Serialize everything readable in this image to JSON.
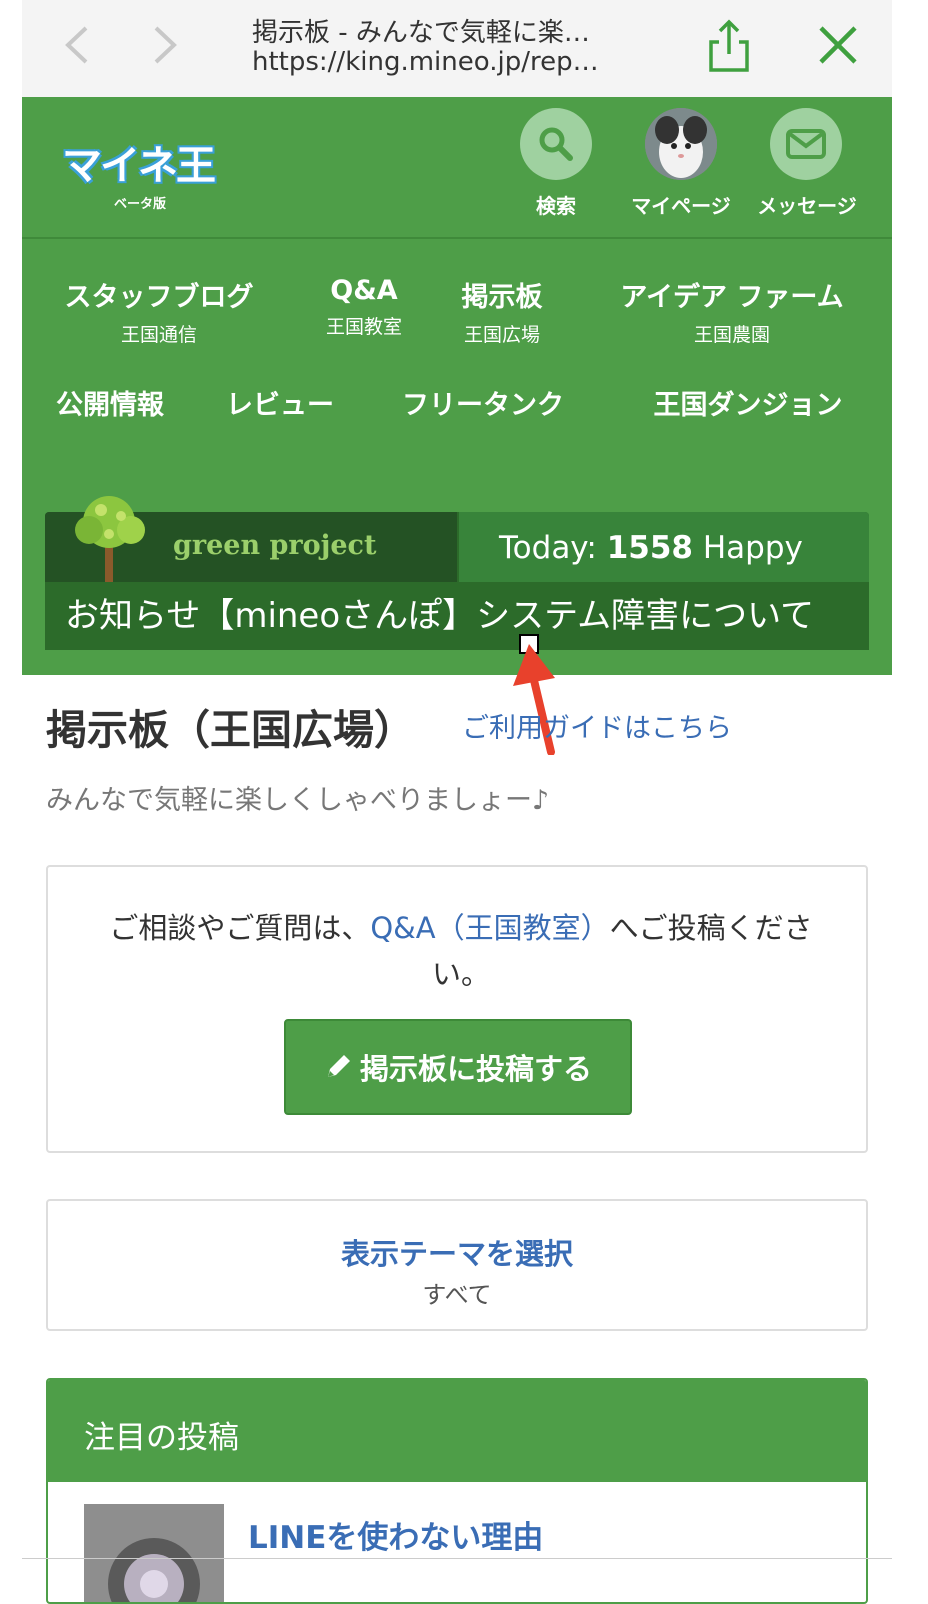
{
  "browser": {
    "title": "掲示板 - みんなで気軽に楽…",
    "url": "https://king.mineo.jp/rep…",
    "back_icon": "chevron-left-icon",
    "forward_icon": "chevron-right-icon",
    "share_icon": "share-icon",
    "close_icon": "close-icon"
  },
  "header": {
    "logo_text": "マイネ王",
    "logo_sub": "ベータ版",
    "actions": [
      {
        "label": "検索",
        "icon": "search-icon"
      },
      {
        "label": "マイページ",
        "icon": "avatar"
      },
      {
        "label": "メッセージ",
        "icon": "envelope-icon"
      }
    ],
    "nav_row1": [
      {
        "label": "スタッフブログ",
        "sub": "王国通信"
      },
      {
        "label": "Q&A",
        "sub": "王国教室"
      },
      {
        "label": "掲示板",
        "sub": "王国広場"
      },
      {
        "label": "アイデア ファーム",
        "sub": "王国農園"
      }
    ],
    "nav_row2": [
      {
        "label": "公開情報"
      },
      {
        "label": "レビュー"
      },
      {
        "label": "フリータンク"
      },
      {
        "label": "王国ダンジョン"
      }
    ]
  },
  "green_project": {
    "logo_text": "green project",
    "today_prefix": "Today: ",
    "today_count": "1558",
    "today_suffix": " Happy",
    "notice": "お知らせ【mineoさんぽ】システム障害について"
  },
  "main": {
    "title": "掲示板（王国広場）",
    "guide_link": "ご利用ガイドはこちら",
    "subtitle": "みんなで気軽に楽しくしゃべりましょー♪",
    "qa_prefix": "ご相談やご質問は、",
    "qa_link": "Q&A（王国教室）",
    "qa_suffix": "へご投稿ください。",
    "post_button": "掲示板に投稿する",
    "post_icon": "pencil-icon",
    "theme_title": "表示テーマを選択",
    "theme_value": "すべて",
    "featured_title": "注目の投稿",
    "featured_item": "LINEを使わない理由"
  },
  "colors": {
    "brand_green": "#4e9e48",
    "link_blue": "#3a6db5",
    "arrow_red": "#e8412c"
  }
}
